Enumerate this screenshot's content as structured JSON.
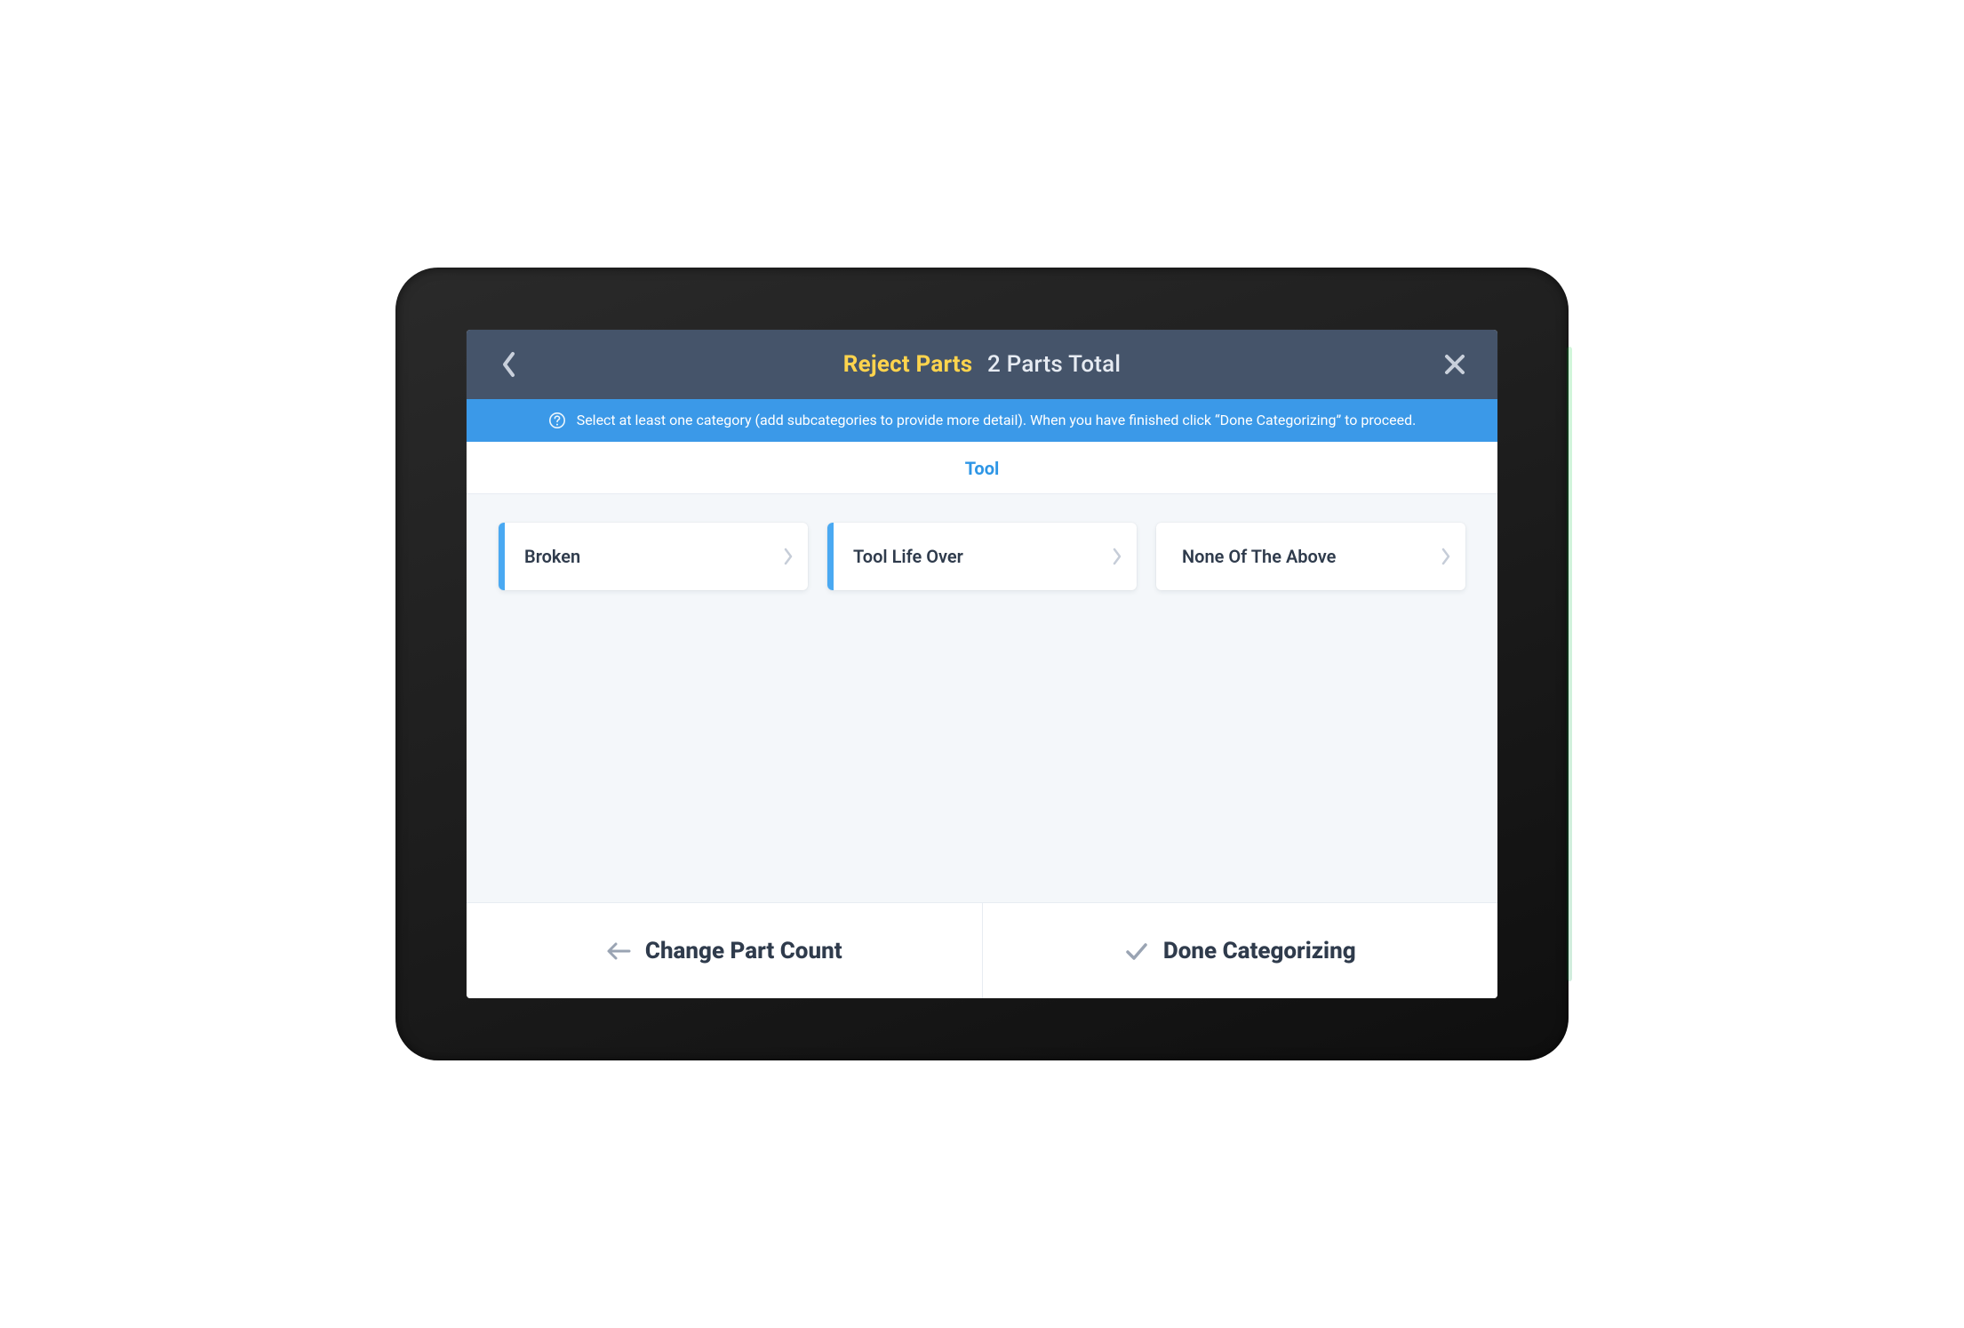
{
  "header": {
    "title": "Reject Parts",
    "subtitle": "2 Parts Total"
  },
  "info": {
    "text": "Select at least one category (add subcategories to provide more detail). When you have finished click “Done Categorizing” to proceed."
  },
  "tab": {
    "active_label": "Tool"
  },
  "options": [
    {
      "label": "Broken",
      "accent": true
    },
    {
      "label": "Tool Life Over",
      "accent": true
    },
    {
      "label": "None Of The Above",
      "accent": false
    }
  ],
  "footer": {
    "left_label": "Change Part Count",
    "right_label": "Done Categorizing"
  }
}
